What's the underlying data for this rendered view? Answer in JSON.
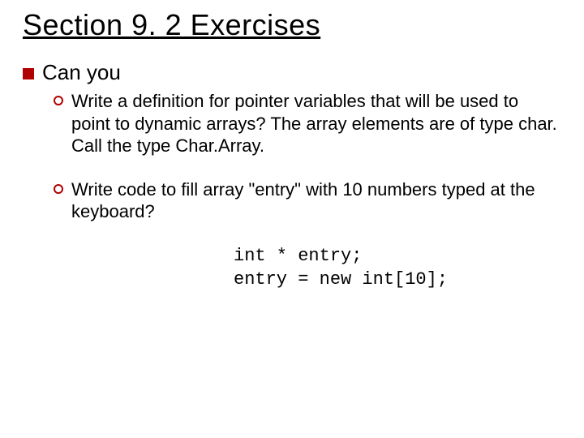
{
  "title": "Section 9. 2 Exercises",
  "level1": "Can you",
  "bullets": [
    "Write a definition for pointer variables that will be used to point to dynamic arrays?  The array elements are of type char.  Call the type Char.Array.",
    "Write code to fill array \"entry\" with 10 numbers typed at the keyboard?"
  ],
  "code": "int * entry;\nentry = new int[10];"
}
